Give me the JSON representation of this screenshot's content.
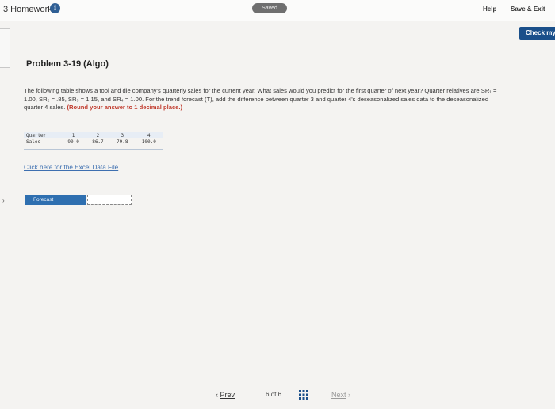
{
  "header": {
    "title": "3 Homework",
    "saved_status": "Saved",
    "help_label": "Help",
    "save_exit_label": "Save & Exit",
    "check_label": "Check my"
  },
  "problem": {
    "title": "Problem 3-19 (Algo)",
    "text": "The following table shows a tool and die company's quarterly sales for the current year. What sales would you predict for the first quarter of next year? Quarter relatives are SR₁ = 1.00, SR₂ = .85, SR₃ = 1.15, and SR₄ = 1.00. For the trend forecast (T), add the difference between quarter 3 and quarter 4's deseasonalized sales data to the deseasonalized quarter 4 sales.",
    "emphasis": "(Round your answer to 1 decimal place.)",
    "table": {
      "quarter_label": "Quarter",
      "sales_label": "Sales",
      "quarters": [
        "1",
        "2",
        "3",
        "4"
      ],
      "sales": [
        "90.0",
        "86.7",
        "79.8",
        "100.0"
      ]
    },
    "excel_link": "Click here for the Excel Data File",
    "forecast_label": "Forecast",
    "forecast_value": ""
  },
  "nav": {
    "prev_label": "Prev",
    "page_current": "6",
    "page_of": "of",
    "page_total": "6",
    "next_label": "Next"
  },
  "colors": {
    "accent": "#1a4f8a",
    "forecast_bg": "#2e6fb0",
    "emphasis": "#c0392b",
    "link": "#3d6fb0"
  }
}
